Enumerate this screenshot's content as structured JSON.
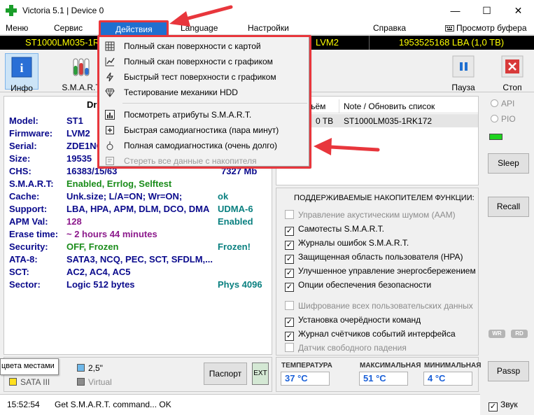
{
  "window": {
    "title": "Victoria 5.1 | Device 0",
    "minimize": "—",
    "maximize": "☐",
    "close": "✕"
  },
  "menu": {
    "items": [
      "Меню",
      "Сервис",
      "Действия",
      "Language",
      "Настройки",
      "Справка"
    ],
    "buffer_view": "Просмотр буфера"
  },
  "device_strip": {
    "model_left": "ST1000LM035-1R",
    "model_right": "LVM2",
    "capacity": "1953525168 LBA (1,0 TB)"
  },
  "toolbar": {
    "info": "Инфо",
    "smart": "S.M.A.R.T",
    "pause": "Пауза",
    "stop": "Стоп"
  },
  "info": {
    "header": "Dr",
    "rows": [
      {
        "label": "Model:",
        "value": "ST1",
        "extra": ""
      },
      {
        "label": "Firmware:",
        "value": "LVM2",
        "extra": ""
      },
      {
        "label": "Serial:",
        "value": "ZDE1NC",
        "extra": ""
      },
      {
        "label": "Size:",
        "value": "19535",
        "extra": ""
      },
      {
        "label": "CHS:",
        "value": "16383/15/63",
        "extra": "7327 Mb"
      },
      {
        "label": "S.M.A.R.T:",
        "value": "Enabled, Errlog, Selftest",
        "extra": ""
      },
      {
        "label": "Cache:",
        "value": "Unk.size; L/A=ON; Wr=ON;",
        "extra": "ok"
      },
      {
        "label": "Support:",
        "value": "LBA, HPA, APM, DLM, DCO, DMA",
        "extra": "UDMA-6"
      },
      {
        "label": "APM Val:",
        "value": "128",
        "extra": "Enabled"
      },
      {
        "label": "Erase time:",
        "value": "~ 2 hours 44 minutes",
        "extra": ""
      },
      {
        "label": "Security:",
        "value": "OFF, Frozen",
        "extra": "Frozen!"
      },
      {
        "label": "ATA-8:",
        "value": "SATA3, NCQ, PEC, SCT, SFDLM,...",
        "extra": ""
      },
      {
        "label": "SCT:",
        "value": "AC2, AC4, AC5",
        "extra": ""
      },
      {
        "label": "Sector:",
        "value": "Logic 512 bytes",
        "extra": "Phys 4096"
      }
    ]
  },
  "drives": {
    "col_size": "ъём",
    "col_note": "Note / Обновить список",
    "row_size": "0 TB",
    "row_note": "ST1000LM035-1RK172"
  },
  "features": {
    "title": "ПОДДЕРЖИВАЕМЫЕ НАКОПИТЕЛЕМ ФУНКЦИИ:",
    "items": [
      {
        "label": "Управление акустическим шумом (AAM)",
        "checked": false,
        "enabled": false
      },
      {
        "label": "Самотесты S.M.A.R.T.",
        "checked": true,
        "enabled": true
      },
      {
        "label": "Журналы ошибок S.M.A.R.T.",
        "checked": true,
        "enabled": true
      },
      {
        "label": "Защищенная область пользователя (HPA)",
        "checked": true,
        "enabled": true
      },
      {
        "label": "Улучшенное управление энергосбережением",
        "checked": true,
        "enabled": true
      },
      {
        "label": "Опции обеспечения безопасности",
        "checked": true,
        "enabled": true
      },
      {
        "label": "Шифрование всех пользовательских данных",
        "checked": false,
        "enabled": false
      },
      {
        "label": "Установка очерёдности команд",
        "checked": true,
        "enabled": true
      },
      {
        "label": "Журнал счётчиков событий интерфейса",
        "checked": true,
        "enabled": true
      },
      {
        "label": "Датчик свободного падения",
        "checked": false,
        "enabled": false
      }
    ]
  },
  "right": {
    "api": "API",
    "pio": "PIO",
    "sleep": "Sleep",
    "recall": "Recall",
    "wr": "WR",
    "rd": "RD",
    "passp": "Passp",
    "sound": "Звук"
  },
  "bottom": {
    "tooltip": "цвета местами",
    "size_25": "2,5\"",
    "sata": "SATA III",
    "virtual": "Virtual",
    "passport": "Паспорт",
    "ext": "EXT"
  },
  "temps": {
    "temp_label": "ТЕМПЕРАТУРА",
    "temp_value": "37 °C",
    "max_label": "МАКСИМАЛЬНАЯ",
    "max_value": "51 °C",
    "min_label": "МИНИМАЛЬНАЯ",
    "min_value": "4 °C"
  },
  "status": {
    "time": "15:52:54",
    "message": "Get S.M.A.R.T. command... OK"
  },
  "dropdown": {
    "items": [
      {
        "label": "Полный скан поверхности с картой",
        "icon": "grid-icon",
        "enabled": true
      },
      {
        "label": "Полный скан поверхности с графиком",
        "icon": "graph-icon",
        "enabled": true
      },
      {
        "label": "Быстрый тест поверхности с графиком",
        "icon": "lightning-icon",
        "enabled": true
      },
      {
        "label": "Тестирование механики HDD",
        "icon": "diamond-icon",
        "enabled": true
      },
      {
        "label": "Посмотреть атрибуты S.M.A.R.T.",
        "icon": "chart-icon",
        "enabled": true
      },
      {
        "label": "Быстрая самодиагностика (пара минут)",
        "icon": "plus-box-icon",
        "enabled": true
      },
      {
        "label": "Полная самодиагностика (очень долго)",
        "icon": "bulb-icon",
        "enabled": true
      },
      {
        "label": "Стереть все данные с накопителя",
        "icon": "erase-icon",
        "enabled": false
      }
    ]
  },
  "colors": {
    "annotation_red": "#e8363c",
    "menu_highlight": "#1f6fd0",
    "strip_text": "#ffff00",
    "temp_blue": "#1a60d8"
  }
}
